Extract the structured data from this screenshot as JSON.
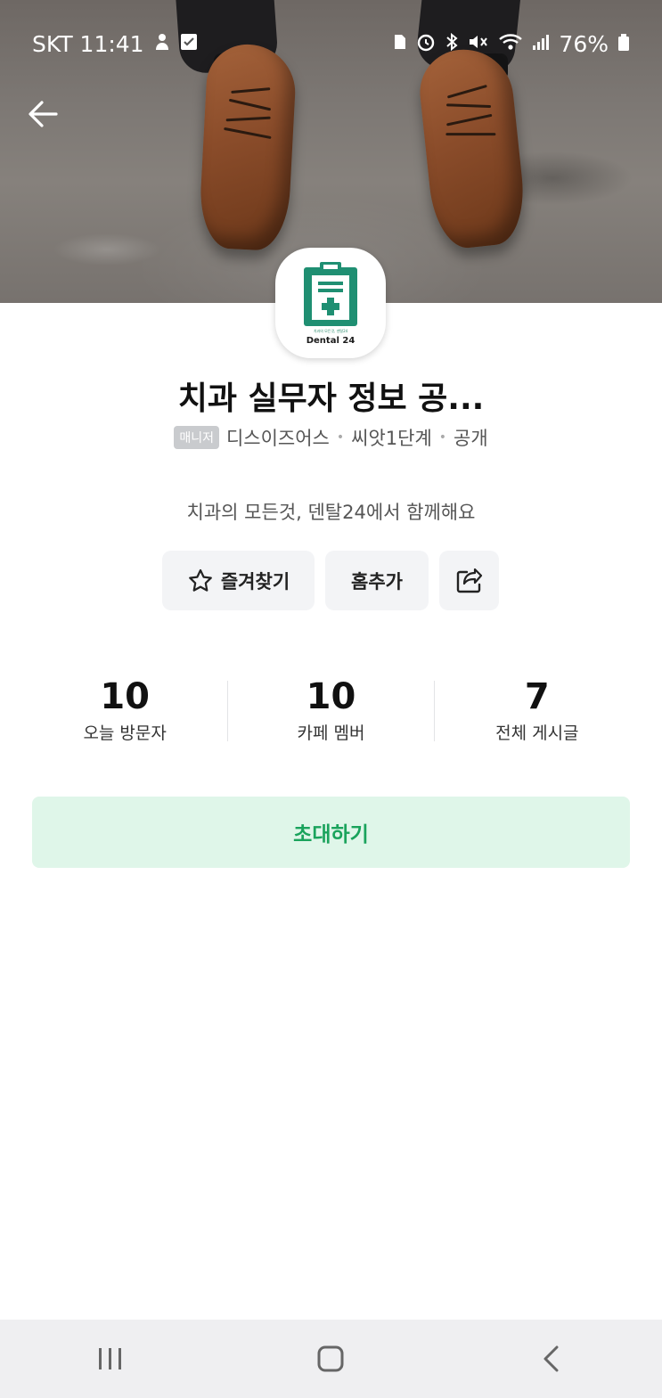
{
  "status_bar": {
    "carrier_time": "SKT 11:41",
    "battery": "76%",
    "icons": [
      "person-icon",
      "checkbox-icon",
      "sim-icon",
      "alarm-icon",
      "bluetooth-icon",
      "mute-icon",
      "wifi-icon",
      "signal-icon",
      "battery-icon"
    ]
  },
  "header": {
    "back_icon": "arrow-left-icon"
  },
  "cafe": {
    "logo_text": "Dental 24",
    "logo_tagline": "치과의 모든것, 덴탈24",
    "title": "치과 실무자 정보 공...",
    "manager_badge": "매니저",
    "owner": "디스이즈어스",
    "level": "씨앗1단계",
    "visibility": "공개",
    "description": "치과의 모든것, 덴탈24에서 함께해요"
  },
  "actions": {
    "favorite_label": "즐겨찾기",
    "add_home_label": "홈추가",
    "favorite_icon": "star-icon",
    "share_icon": "share-icon"
  },
  "stats": [
    {
      "value": "10",
      "label": "오늘 방문자"
    },
    {
      "value": "10",
      "label": "카페 멤버"
    },
    {
      "value": "7",
      "label": "전체 게시글"
    }
  ],
  "invite_label": "초대하기",
  "colors": {
    "accent_green": "#1aa35c",
    "invite_bg": "#dff6e9",
    "logo_teal": "#1f8f72"
  },
  "nav_bar": {
    "icons": [
      "recent-apps-icon",
      "home-icon",
      "back-icon"
    ]
  }
}
